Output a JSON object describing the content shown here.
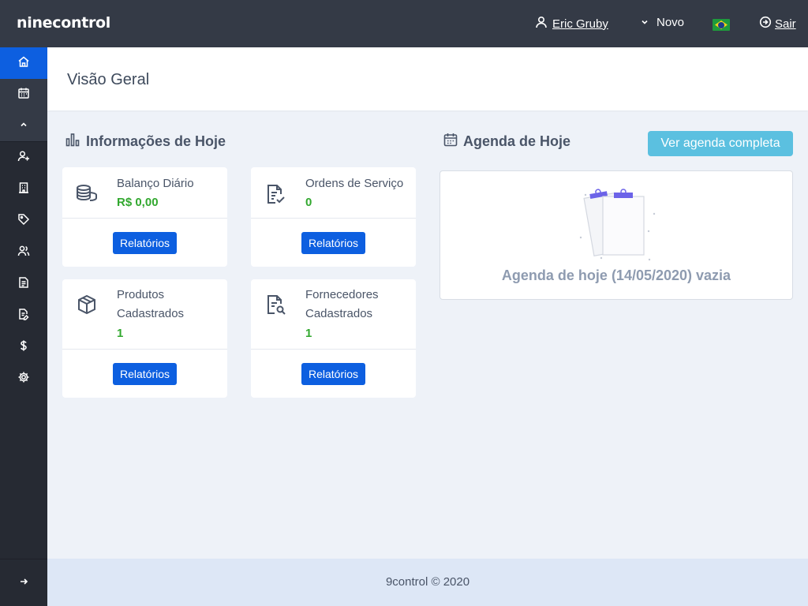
{
  "header": {
    "logo": "ninecontrol",
    "user_name": "Eric Gruby",
    "novo_label": "Novo",
    "logout_label": "Sair"
  },
  "sidebar": {
    "items": [
      {
        "icon": "home-icon",
        "active": true
      },
      {
        "icon": "calendar-icon"
      },
      {
        "icon": "chevron-up-icon"
      },
      {
        "icon": "user-plus-icon"
      },
      {
        "icon": "building-icon"
      },
      {
        "icon": "tag-icon"
      },
      {
        "icon": "users-icon"
      },
      {
        "icon": "document-list-icon"
      },
      {
        "icon": "document-edit-icon"
      },
      {
        "icon": "dollar-icon"
      },
      {
        "icon": "gear-icon"
      }
    ],
    "collapse_icon": "arrow-right-icon"
  },
  "page": {
    "title": "Visão Geral"
  },
  "info": {
    "title": "Informações de Hoje",
    "cards": [
      {
        "label": "Balanço Diário",
        "value": "R$ 0,00",
        "button": "Relatórios",
        "icon": "coins-icon"
      },
      {
        "label": "Ordens de Serviço",
        "value": "0",
        "button": "Relatórios",
        "icon": "document-check-icon"
      },
      {
        "label_line1": "Produtos",
        "label_line2": "Cadastrados",
        "value": "1",
        "button": "Relatórios",
        "icon": "box-icon"
      },
      {
        "label_line1": "Fornecedores",
        "label_line2": "Cadastrados",
        "value": "1",
        "button": "Relatórios",
        "icon": "document-search-icon"
      }
    ]
  },
  "agenda": {
    "title": "Agenda de Hoje",
    "button": "Ver agenda completa",
    "empty_text": "Agenda de hoje (14/05/2020) vazia"
  },
  "footer": {
    "text": "9control © 2020"
  },
  "colors": {
    "topbar": "#343a46",
    "sidebar": "#262a33",
    "accent": "#0d5fe0",
    "value_green": "#32a82f",
    "agenda_button": "#5bc0e0"
  }
}
